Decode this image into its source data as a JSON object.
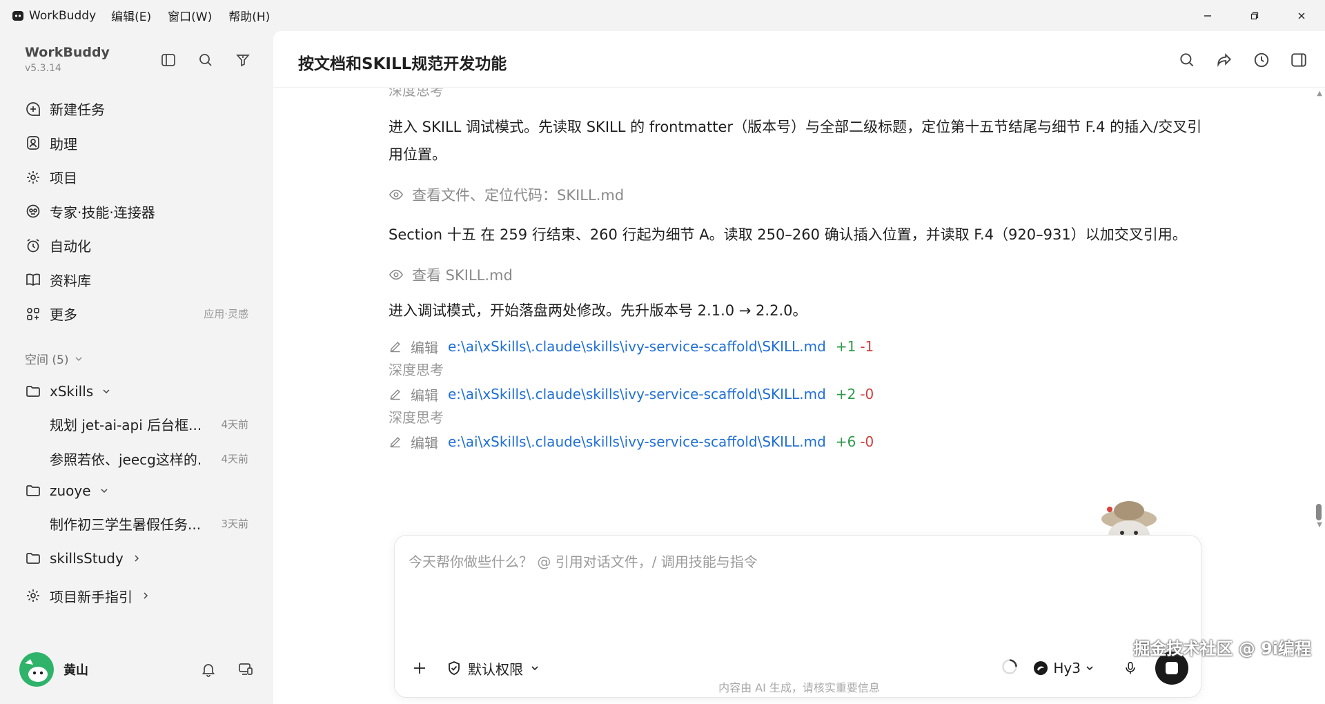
{
  "titlebar": {
    "app_name": "WorkBuddy",
    "menus": [
      "编辑(E)",
      "窗口(W)",
      "帮助(H)"
    ]
  },
  "sidebar": {
    "brand": "WorkBuddy",
    "version": "v5.3.14",
    "nav": [
      {
        "label": "新建任务",
        "icon": "new-task-icon"
      },
      {
        "label": "助理",
        "icon": "assistant-icon"
      },
      {
        "label": "项目",
        "icon": "project-icon"
      },
      {
        "label": "专家·技能·连接器",
        "icon": "expert-icon"
      },
      {
        "label": "自动化",
        "icon": "alarm-icon"
      },
      {
        "label": "资料库",
        "icon": "book-icon"
      },
      {
        "label": "更多",
        "icon": "apps-icon",
        "hint": "应用·灵感"
      }
    ],
    "space_label": "空间 (5)",
    "tree": {
      "folder1": "xSkills",
      "task1": {
        "title": "规划 jet-ai-api 后台框...",
        "time": "4天前"
      },
      "task2": {
        "title": "参照若依、jeecg这样的...",
        "time": "4天前"
      },
      "folder2": "zuoye",
      "task3": {
        "title": "制作初三学生暑假任务...",
        "time": "3天前"
      },
      "folder3": "skillsStudy",
      "folder4": "项目新手指引"
    },
    "user_name": "黄山"
  },
  "main": {
    "title": "按文档和SKILL规范开发功能",
    "top_faded": "深度思考",
    "para1": "进入 SKILL 调试模式。先读取 SKILL 的 frontmatter（版本号）与全部二级标题，定位第十五节结尾与细节 F.4 的插入/交叉引用位置。",
    "tool1": "查看文件、定位代码：SKILL.md",
    "para2": "Section 十五 在 259 行结束、260 行起为细节 A。读取 250–260 确认插入位置，并读取 F.4（920–931）以加交叉引用。",
    "tool2": "查看 SKILL.md",
    "para3": "进入调试模式，开始落盘两处修改。先升版本号 2.1.0 → 2.2.0。",
    "edits": [
      {
        "verb": "编辑",
        "path": "e:\\ai\\xSkills\\.claude\\skills\\ivy-service-scaffold\\SKILL.md",
        "add": "+1",
        "del": "-1"
      },
      {
        "verb": "编辑",
        "path": "e:\\ai\\xSkills\\.claude\\skills\\ivy-service-scaffold\\SKILL.md",
        "add": "+2",
        "del": "-0"
      },
      {
        "verb": "编辑",
        "path": "e:\\ai\\xSkills\\.claude\\skills\\ivy-service-scaffold\\SKILL.md",
        "add": "+6",
        "del": "-0"
      }
    ],
    "thinking_label": "深度思考"
  },
  "composer": {
    "placeholder": "今天帮你做些什么？ @ 引用对话文件，/ 调用技能与指令",
    "permission": "默认权限",
    "model": "Hy3"
  },
  "footer_note": "内容由 AI 生成，请核实重要信息",
  "watermark": "掘金技术社区 @ 9i编程",
  "colors": {
    "accent_link": "#1f6fd6",
    "diff_add": "#2e9a4a",
    "diff_del": "#d23d3d"
  }
}
